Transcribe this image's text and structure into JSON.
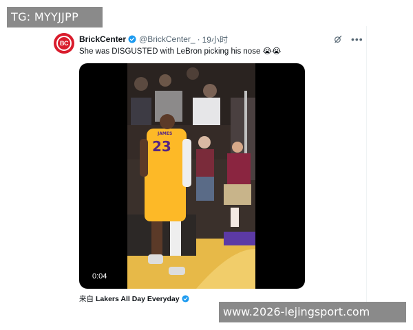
{
  "watermarks": {
    "top": "TG: MYYJJPP",
    "bottom": "www.2026-lejingsport.com"
  },
  "tweet": {
    "display_name": "BrickCenter",
    "handle": "@BrickCenter_",
    "separator": "·",
    "time": "19小时",
    "text": "She was DISGUSTED with LeBron picking his nose 😭😭",
    "video_duration": "0:04",
    "jersey_number": "23",
    "jersey_name": "JAMES",
    "source_prefix": "来自",
    "source_name": "Lakers All Day Everyday",
    "avatar_text": "BC",
    "verified_color": "#1d9bf0"
  },
  "icons": {
    "verified": "verified-badge-icon",
    "grok": "grok-icon",
    "more": "more-options-icon"
  }
}
